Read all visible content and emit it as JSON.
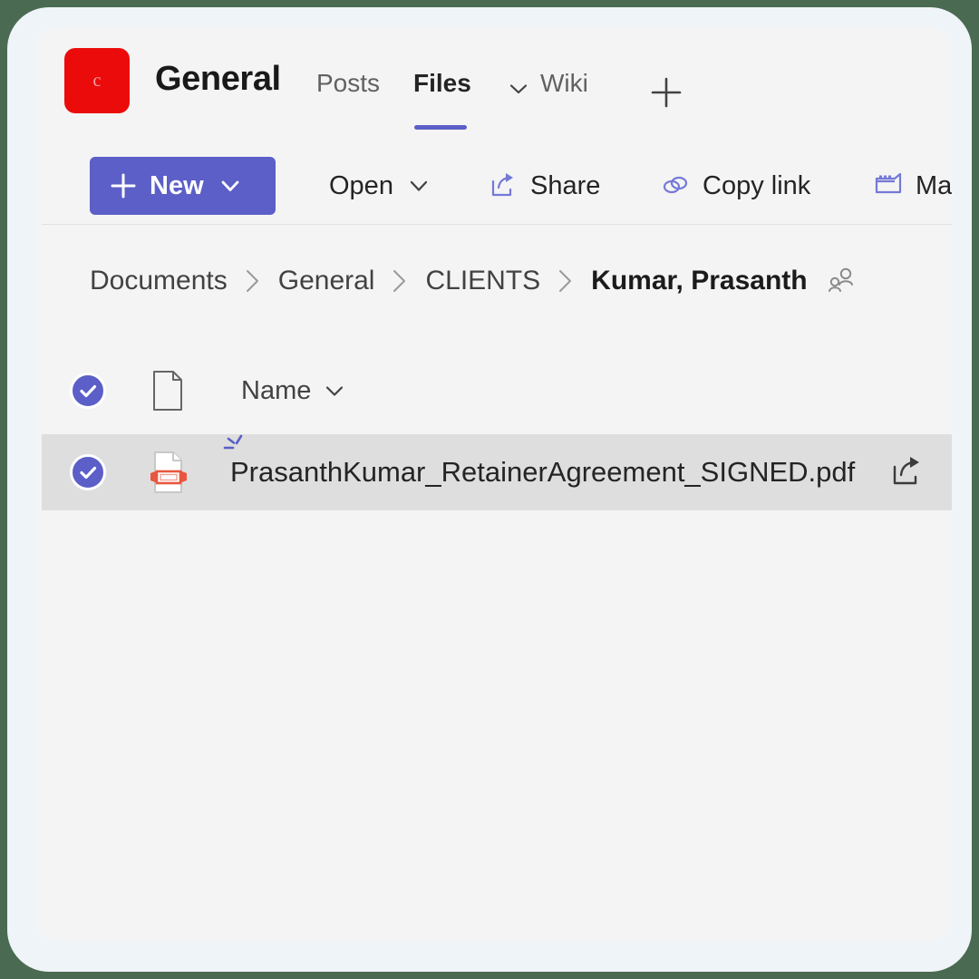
{
  "theme": {
    "backdrop": "#4a6b52",
    "card_bg": "#eff4f8",
    "panel_bg": "#f4f4f4",
    "accent": "#5b5fc7",
    "avatar_bg": "#ec0b0b",
    "selected_row_bg": "#dedede",
    "pdf_red": "#e8563f"
  },
  "channel": {
    "team_avatar_letter": "c",
    "title": "General",
    "tabs": [
      {
        "label": "Posts",
        "active": false,
        "has_chevron": false
      },
      {
        "label": "Files",
        "active": true,
        "has_chevron": true
      },
      {
        "label": "Wiki",
        "active": false,
        "has_chevron": false
      }
    ],
    "add_tab_icon": "plus-icon"
  },
  "command_bar": {
    "new_button": {
      "label": "New",
      "plus_icon": "plus-icon",
      "chevron_icon": "chevron-down-icon"
    },
    "items": [
      {
        "label": "Open",
        "icon": null,
        "chevron": true
      },
      {
        "label": "Share",
        "icon": "share-icon",
        "chevron": false
      },
      {
        "label": "Copy link",
        "icon": "link-icon",
        "chevron": false
      },
      {
        "label": "Ma",
        "icon": "window-icon",
        "chevron": false
      }
    ]
  },
  "breadcrumb": {
    "items": [
      {
        "label": "Documents",
        "current": false
      },
      {
        "label": "General",
        "current": false
      },
      {
        "label": "CLIENTS",
        "current": false
      },
      {
        "label": "Kumar, Prasanth",
        "current": true
      }
    ],
    "separator": "chevron-right-icon",
    "shared_icon": "people-icon"
  },
  "file_list": {
    "header": {
      "select_all_icon": "checkmark-circle-icon",
      "type_column_icon": "document-icon",
      "name_label": "Name",
      "name_sort_icon": "chevron-down-icon"
    },
    "rows": [
      {
        "selected": true,
        "select_icon": "checkmark-circle-icon",
        "file_icon": "pdf-file-icon",
        "new_badge_icon": "sparkle-icon",
        "name": "PrasanthKumar_RetainerAgreement_SIGNED.pdf",
        "share_icon": "share-icon"
      }
    ]
  }
}
